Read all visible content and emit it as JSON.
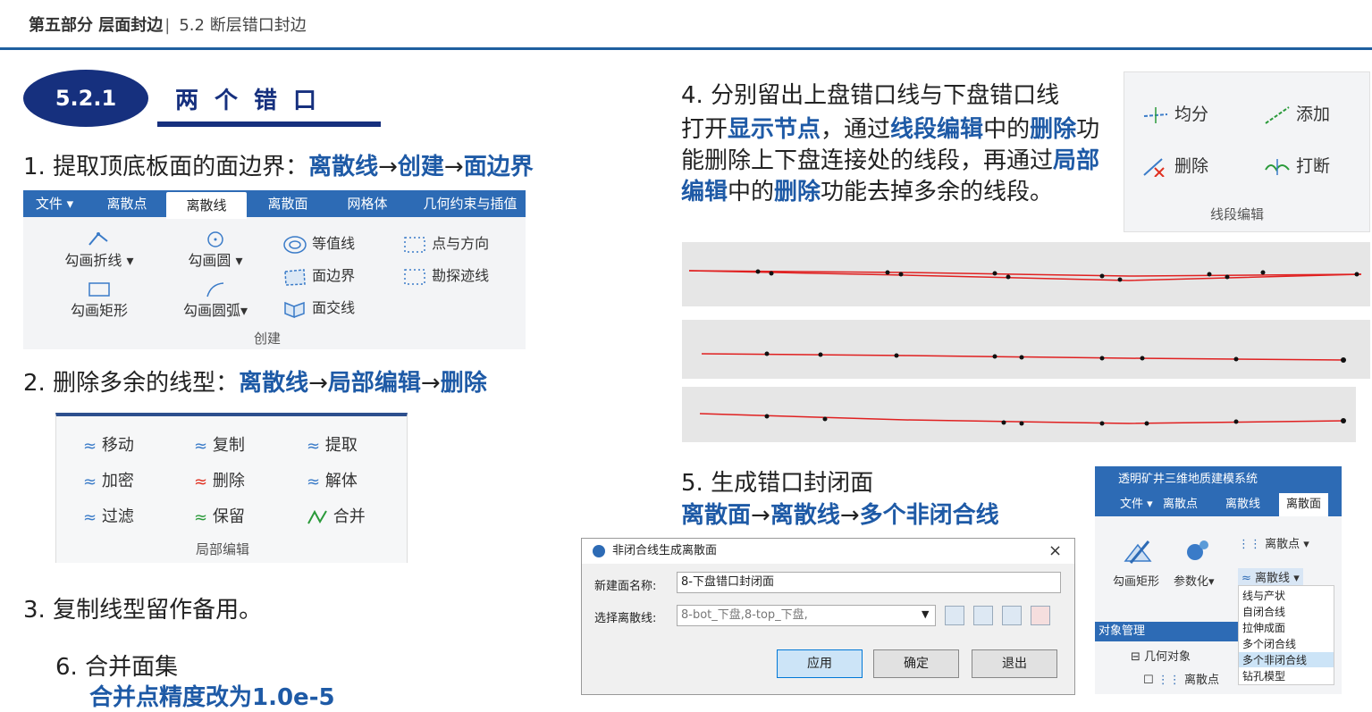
{
  "header": {
    "part": "第五部分 层面封边",
    "divider": "|",
    "section": "5.2 断层错口封边"
  },
  "badge": {
    "number": "5.2.1",
    "title": "两个错口"
  },
  "steps": {
    "s1": {
      "text": "1. 提取顶底板面的面边界：",
      "path": [
        "离散线",
        "创建",
        "面边界"
      ]
    },
    "s2": {
      "text": "2. 删除多余的线型：",
      "path": [
        "离散线",
        "局部编辑",
        "删除"
      ]
    },
    "s3": {
      "text": "3. 复制线型留作备用。"
    },
    "s4": {
      "heading": "4. 分别留出上盘错口线与下盘错口线",
      "p1": "打开",
      "h1": "显示节点",
      "p2": "，通过",
      "h2": "线段编辑",
      "p3": "中的",
      "h3": "删除",
      "p4": "功能删除上下盘连接处的线段，再通过",
      "h4": "局部编辑",
      "p5": "中的",
      "h5": "删除",
      "p6": "功能去掉多余的线段。"
    },
    "s5": {
      "heading": "5. 生成错口封闭面",
      "path": [
        "离散面",
        "离散线",
        "多个非闭合线"
      ]
    },
    "s6": {
      "heading": "6. 合并面集",
      "sub": "合并点精度改为1.0e-5"
    },
    "arrow": "→"
  },
  "ribbon_create": {
    "tabs": [
      "文件",
      "离散点",
      "离散线",
      "离散面",
      "网格体",
      "几何约束与插值"
    ],
    "selected_tab": "离散线",
    "items": {
      "polyline": "勾画折线",
      "circle": "勾画圆",
      "rect": "勾画矩形",
      "arc": "勾画圆弧",
      "contour": "等值线",
      "boundary": "面边界",
      "intersect": "面交线",
      "point_dir": "点与方向",
      "survey": "勘探迹线"
    },
    "group": "创建"
  },
  "ribbon_local_edit": {
    "items": [
      "移动",
      "复制",
      "提取",
      "加密",
      "删除",
      "解体",
      "过滤",
      "保留",
      "合并"
    ],
    "group": "局部编辑"
  },
  "segment_edit": {
    "items": [
      "均分",
      "添加",
      "删除",
      "打断"
    ],
    "group": "线段编辑"
  },
  "dialog": {
    "title": "非闭合线生成离散面",
    "name_label": "新建面名称:",
    "name_value": "8-下盘错口封闭面",
    "select_label": "选择离散线:",
    "select_value": "8-bot_下盘,8-top_下盘,",
    "buttons": [
      "应用",
      "确定",
      "退出"
    ],
    "close": "×"
  },
  "app": {
    "title": "透明矿井三维地质建模系统",
    "menu": [
      "文件",
      "离散点",
      "离散线",
      "离散面"
    ],
    "selected_menu": "离散面",
    "tools": {
      "rect": "勾画矩形",
      "param": "参数化",
      "pts": "离散点",
      "lines": "离散线"
    },
    "dropdown": [
      "线与产状",
      "自闭合线",
      "拉伸成面",
      "多个闭合线",
      "多个非闭合线",
      "钻孔模型"
    ],
    "obj_panel": "对象管理",
    "tree": {
      "geom": "几何对象",
      "pts": "离散点"
    }
  },
  "colors": {
    "accent": "#1e5aa6",
    "navy": "#16307e",
    "ribbon": "#2d6bb5",
    "line": "#e02020"
  }
}
